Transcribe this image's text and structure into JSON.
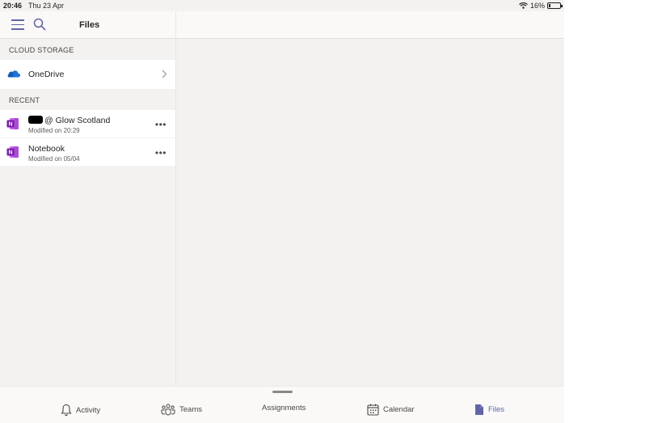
{
  "status": {
    "time": "20:46",
    "date": "Thu 23 Apr",
    "battery": "16%",
    "battery_level": 0.16
  },
  "header": {
    "title": "Files",
    "menu_icon": "hamburger-menu-icon",
    "search_icon": "search-icon"
  },
  "cloud": {
    "section_label": "CLOUD STORAGE",
    "items": [
      {
        "label": "OneDrive",
        "icon": "onedrive-icon"
      }
    ]
  },
  "recent": {
    "section_label": "RECENT",
    "items": [
      {
        "title": "@ Glow Scotland",
        "subtitle": "Modified on 20:29",
        "icon": "onenote-icon"
      },
      {
        "title": "Notebook",
        "subtitle": "Modified on 05/04",
        "icon": "onenote-icon"
      }
    ]
  },
  "tabs": [
    {
      "label": "Activity",
      "icon": "bell-icon"
    },
    {
      "label": "Teams",
      "icon": "teams-icon"
    },
    {
      "label": "Assignments",
      "icon": ""
    },
    {
      "label": "Calendar",
      "icon": "calendar-icon"
    },
    {
      "label": "Files",
      "icon": "file-icon",
      "active": true
    }
  ],
  "colors": {
    "accent": "#6264a7",
    "onedrive": "#0f5bb5",
    "onenote": "#7719aa",
    "background": "#f3f2f1"
  }
}
